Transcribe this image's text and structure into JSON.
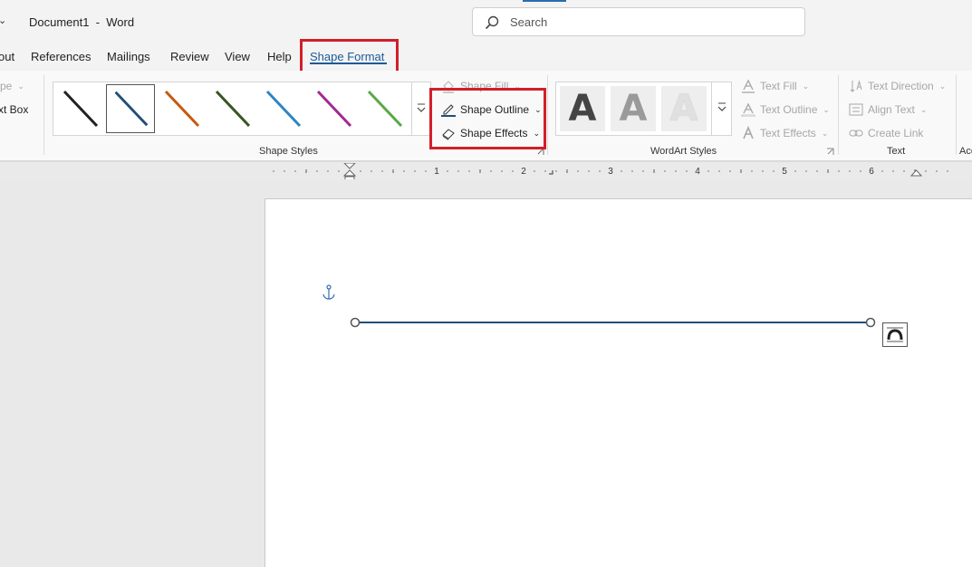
{
  "titlebar": {
    "qat_caret": "⌄",
    "title": "Document1  -  Word",
    "search_placeholder": "Search"
  },
  "tabs": {
    "items": [
      "out",
      "References",
      "Mailings",
      "Review",
      "View",
      "Help",
      "Shape Format"
    ],
    "active": "Shape Format"
  },
  "ribbon": {
    "left_partial": {
      "shape_label": "pe",
      "text_box_label": "xt Box"
    },
    "shape_styles": {
      "label": "Shape Styles",
      "swatch_colors": [
        "#222222",
        "#1f4e79",
        "#c55a11",
        "#375623",
        "#2e86c1",
        "#a02b93",
        "#5aa845"
      ],
      "selected_index": 1,
      "shape_fill": "Shape Fill",
      "shape_outline": "Shape Outline",
      "shape_effects": "Shape Effects"
    },
    "wordart_styles": {
      "label": "WordArt Styles",
      "letter": "A",
      "text_fill": "Text Fill",
      "text_outline": "Text Outline",
      "text_effects": "Text Effects"
    },
    "text_group": {
      "label": "Text",
      "text_direction": "Text Direction",
      "align_text": "Align Text",
      "create_link": "Create Link"
    },
    "next_group_partial": "Acc"
  },
  "ruler": {
    "numbers": [
      "1",
      "2",
      "3",
      "4",
      "5",
      "6"
    ]
  },
  "colors": {
    "accent": "#1d5a9a",
    "highlight": "#d11f2a",
    "line": "#1f4e79"
  }
}
